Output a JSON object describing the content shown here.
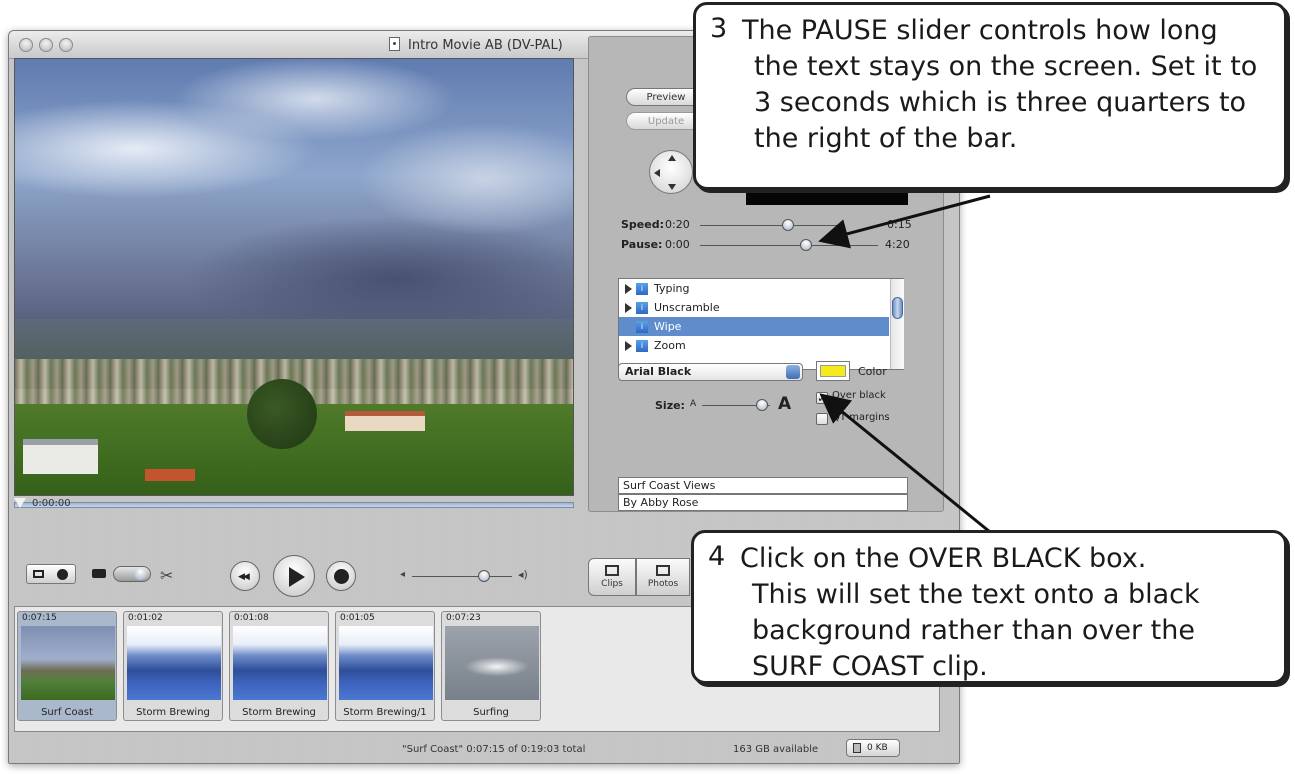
{
  "window": {
    "title": "Intro Movie AB (DV-PAL)"
  },
  "viewer": {
    "timecode": "0:00:00"
  },
  "titles_panel": {
    "preview_label": "Preview",
    "update_label": "Update",
    "speed": {
      "label": "Speed:",
      "min": "0:20",
      "max": "0:15"
    },
    "pause": {
      "label": "Pause:",
      "min": "0:00",
      "max": "4:20"
    },
    "styles": [
      {
        "name": "Typing",
        "expandable": true,
        "selected": false
      },
      {
        "name": "Unscramble",
        "expandable": true,
        "selected": false
      },
      {
        "name": "Wipe",
        "expandable": false,
        "selected": true
      },
      {
        "name": "Zoom",
        "expandable": true,
        "selected": false
      }
    ],
    "font": "Arial Black",
    "color_label": "Color",
    "color_value": "#f7ea1c",
    "size_label": "Size:",
    "size_small": "A",
    "size_large": "A",
    "over_black_label": "Over black",
    "over_black_checked": "✓",
    "qt_margins_label": "QT margins",
    "text_line1": "Surf Coast Views",
    "text_line2": "By Abby Rose"
  },
  "toolbar": {
    "clips_label": "Clips",
    "photos_label": "Photos"
  },
  "clips": [
    {
      "time": "0:07:15",
      "name": "Surf Coast"
    },
    {
      "time": "0:01:02",
      "name": "Storm Brewing"
    },
    {
      "time": "0:01:08",
      "name": "Storm Brewing"
    },
    {
      "time": "0:01:05",
      "name": "Storm Brewing/1"
    },
    {
      "time": "0:07:23",
      "name": "Surfing"
    }
  ],
  "status": {
    "summary": "\"Surf Coast\"  0:07:15 of 0:19:03 total",
    "disk": "163 GB available",
    "trash": "0 KB"
  },
  "callouts": [
    {
      "number": "3",
      "lines": [
        "The PAUSE slider controls how long",
        "the text stays on the screen.  Set it to",
        "3 seconds which is three quarters to",
        "the right of the bar."
      ]
    },
    {
      "number": "4",
      "lines": [
        "Click on the OVER BLACK box.",
        "This will set the text onto a black",
        "background rather than over the",
        "SURF COAST clip."
      ]
    }
  ]
}
